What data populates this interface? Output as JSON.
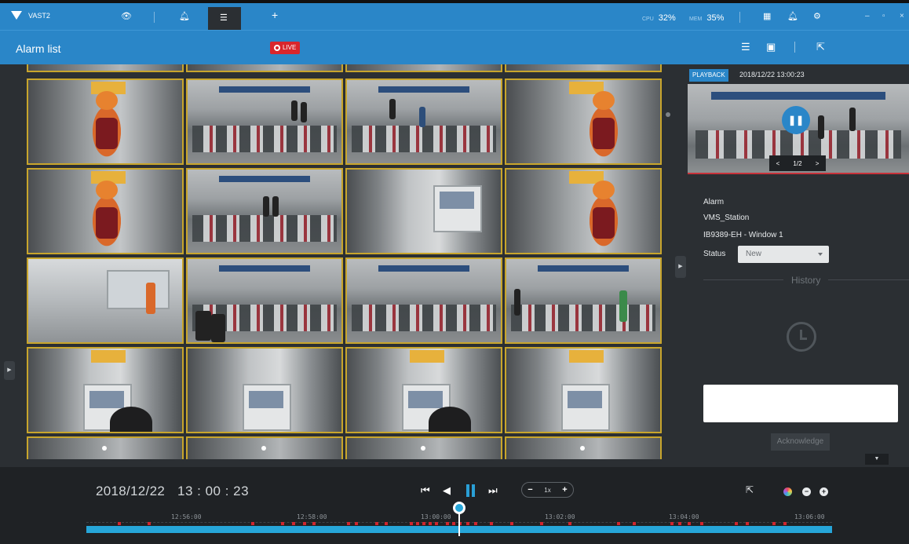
{
  "app": {
    "title": "VAST2",
    "tabs": [
      "view-icon",
      "bell-icon",
      "alarm-list-icon",
      "add-icon"
    ],
    "cpu_label": "CPU",
    "cpu_value": "32%",
    "mem_label": "MEM",
    "mem_value": "35%",
    "window_controls": [
      "–",
      "▫",
      "×"
    ]
  },
  "subbar": {
    "title": "Alarm list",
    "live_label": "LIVE"
  },
  "panel": {
    "playback_tag": "PLAYBACK",
    "playback_time": "2018/12/22 13:00:23",
    "pager_text": "1/2",
    "pager_prev": "<",
    "pager_next": ">",
    "alarm_label": "Alarm",
    "station": "VMS_Station",
    "camera": "IB9389-EH - Window 1",
    "status_label": "Status",
    "status_value": "New",
    "history_label": "History",
    "note_placeholder": "",
    "ack_label": "Acknowledge"
  },
  "bottom": {
    "date": "2018/12/22",
    "time": "13 : 00 : 23",
    "speed_minus": "−",
    "speed_value": "1x",
    "speed_plus": "+",
    "timeline_labels": [
      "12:56:00",
      "12:58:00",
      "13:00:00",
      "13:02:00",
      "13:04:00",
      "13:06:00"
    ]
  },
  "colors": {
    "accent": "#2a86c8",
    "frame_border": "#c8a52c",
    "alarm_mark": "#d0262e",
    "timeline_bar": "#26a6d9"
  }
}
